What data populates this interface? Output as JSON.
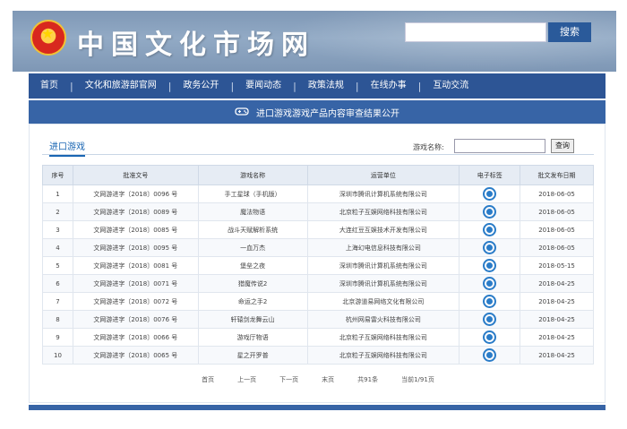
{
  "header": {
    "site_title": "中国文化市场网",
    "search_button": "搜索",
    "search_placeholder": ""
  },
  "nav": {
    "items": [
      "首页",
      "文化和旅游部官网",
      "政务公开",
      "要闻动态",
      "政策法规",
      "在线办事",
      "互动交流"
    ],
    "separator": "|"
  },
  "subbar": {
    "title": "进口游戏游戏产品内容审查结果公开",
    "icon": "gamepad-icon"
  },
  "content": {
    "tab_label": "进口游戏",
    "game_name_label": "游戏名称:",
    "game_name_value": "",
    "query_button": "查询"
  },
  "table": {
    "headers": [
      "序号",
      "批准文号",
      "游戏名称",
      "运营单位",
      "电子标签",
      "批文发布日期"
    ],
    "rows": [
      [
        "1",
        "文网游进字〔2018〕0096 号",
        "手工星球（手机版）",
        "深圳市腾讯计算机系统有限公司",
        "2018-06-05"
      ],
      [
        "2",
        "文网游进字〔2018〕0089 号",
        "魔法物语",
        "北京粒子互娱网络科技有限公司",
        "2018-06-05"
      ],
      [
        "3",
        "文网游进字〔2018〕0085 号",
        "战斗天赋解析系统",
        "大连红豆互娱技术开发有限公司",
        "2018-06-05"
      ],
      [
        "4",
        "文网游进字〔2018〕0095 号",
        "一血万杰",
        "上海幻电信息科技有限公司",
        "2018-06-05"
      ],
      [
        "5",
        "文网游进字〔2018〕0081 号",
        "堡垒之夜",
        "深圳市腾讯计算机系统有限公司",
        "2018-05-15"
      ],
      [
        "6",
        "文网游进字〔2018〕0071 号",
        "猎魔传说2",
        "深圳市腾讯计算机系统有限公司",
        "2018-04-25"
      ],
      [
        "7",
        "文网游进字〔2018〕0072 号",
        "命运之手2",
        "北京游道易网络文化有限公司",
        "2018-04-25"
      ],
      [
        "8",
        "文网游进字〔2018〕0076 号",
        "轩辕剑龙舞云山",
        "杭州网易雷火科技有限公司",
        "2018-04-25"
      ],
      [
        "9",
        "文网游进字〔2018〕0066 号",
        "游戏厅物语",
        "北京粒子互娱网络科技有限公司",
        "2018-04-25"
      ],
      [
        "10",
        "文网游进字〔2018〕0065 号",
        "星之开罗普",
        "北京粒子互娱网络科技有限公司",
        "2018-04-25"
      ]
    ]
  },
  "pager": {
    "first": "首页",
    "prev": "上一页",
    "next": "下一页",
    "last": "末页",
    "total": "共91条",
    "current": "当前1/91页"
  },
  "colors": {
    "nav_bg": "#2d5595",
    "subbar_bg": "#3764a6",
    "accent": "#1a66b3"
  }
}
